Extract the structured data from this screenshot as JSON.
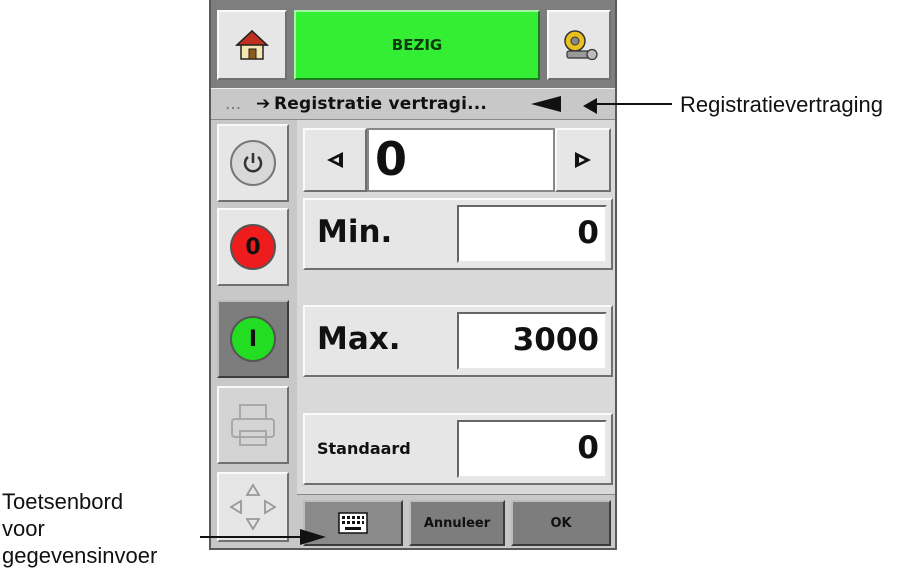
{
  "header": {
    "status": "BEZIG",
    "home_icon": "home-icon",
    "settings_icon": "settings-wrench-icon"
  },
  "breadcrumb": {
    "prefix": "...",
    "arrow": "➔",
    "text": "Registratie vertragi..."
  },
  "input": {
    "value": "0"
  },
  "fields": {
    "min": {
      "label": "Min.",
      "value": "0"
    },
    "max": {
      "label": "Max.",
      "value": "3000"
    },
    "default": {
      "label": "Standaard",
      "value": "0"
    }
  },
  "sidebar": {
    "power_icon": "power-icon",
    "stop_label": "0",
    "start_label": "I",
    "printer_icon": "printer-icon",
    "nav_icon": "navigation-arrows-icon"
  },
  "bottom": {
    "keyboard_icon": "keyboard-icon",
    "cancel": "Annuleer",
    "ok": "OK"
  },
  "annotations": {
    "right": "Registratievertraging",
    "left_line1": "Toetsenbord",
    "left_line2": "voor",
    "left_line3": "gegevensinvoer"
  },
  "colors": {
    "status_green": "#33ee33",
    "stop_red": "#ee1c1c",
    "start_green": "#22dd22"
  }
}
